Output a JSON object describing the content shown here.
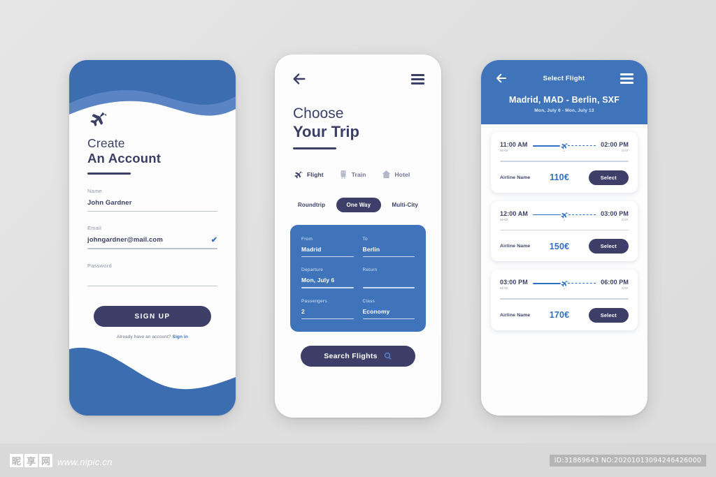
{
  "screen1": {
    "logo_icon": "airplane-icon",
    "title_line1": "Create",
    "title_line2": "An Account",
    "fields": [
      {
        "label": "Name",
        "value": "John Gardner",
        "verified": false
      },
      {
        "label": "Email",
        "value": "johngardner@mail.com",
        "verified": true
      },
      {
        "label": "Password",
        "value": "",
        "verified": false
      }
    ],
    "check_glyph": "✔",
    "signup_label": "SIGN UP",
    "signin_hint": "Already have an account?",
    "signin_link": "Sign in",
    "wave_color_dark": "#3c6db0",
    "wave_color_light": "#5b84c4"
  },
  "screen2": {
    "back_icon": "back-arrow-icon",
    "menu_icon": "hamburger-menu-icon",
    "title_line1": "Choose",
    "title_line2": "Your Trip",
    "modes": [
      {
        "label": "Flight",
        "icon": "airplane-icon",
        "active": true
      },
      {
        "label": "Train",
        "icon": "train-icon",
        "active": false
      },
      {
        "label": "Hotel",
        "icon": "home-icon",
        "active": false
      }
    ],
    "trip_tabs": [
      {
        "label": "Roundtrip",
        "selected": false
      },
      {
        "label": "One Way",
        "selected": true
      },
      {
        "label": "Multi-City",
        "selected": false
      }
    ],
    "search_form": [
      {
        "label": "From",
        "value": "Madrid"
      },
      {
        "label": "To",
        "value": "Berlin"
      },
      {
        "label": "Departure",
        "value": "Mon, July 6"
      },
      {
        "label": "Return",
        "value": ""
      },
      {
        "label": "Passengers",
        "value": "2"
      },
      {
        "label": "Class",
        "value": "Economy"
      }
    ],
    "search_button_label": "Search Flights",
    "search_button_icon": "search-icon",
    "card_color": "#3f74bb"
  },
  "screen3": {
    "back_icon": "back-arrow-icon",
    "menu_icon": "hamburger-menu-icon",
    "header_title": "Select Flight",
    "route": "Madrid, MAD - Berlin, SXF",
    "dates": "Mon, July 6 - Mon, July 13",
    "header_color": "#3f74bb",
    "flights": [
      {
        "depart_time": "11:00 AM",
        "depart_code": "MAD",
        "arrive_time": "02:00 PM",
        "arrive_code": "SXF",
        "stops": "•",
        "airline": "Airline Name",
        "price": "110€",
        "select_label": "Select"
      },
      {
        "depart_time": "12:00 AM",
        "depart_code": "MAD",
        "arrive_time": "03:00 PM",
        "arrive_code": "SXF",
        "stops": "•",
        "airline": "Airline Name",
        "price": "150€",
        "select_label": "Select"
      },
      {
        "depart_time": "03:00 PM",
        "depart_code": "MAD",
        "arrive_time": "06:00 PM",
        "arrive_code": "SXF",
        "stops": "•",
        "airline": "Airline Name",
        "price": "170€",
        "select_label": "Select"
      }
    ]
  },
  "watermark": {
    "logo_chars": [
      "昵",
      "享",
      "网"
    ],
    "url": "www.nipic.cn",
    "id_text": "ID:31869643 NO:20201013094246426000"
  }
}
